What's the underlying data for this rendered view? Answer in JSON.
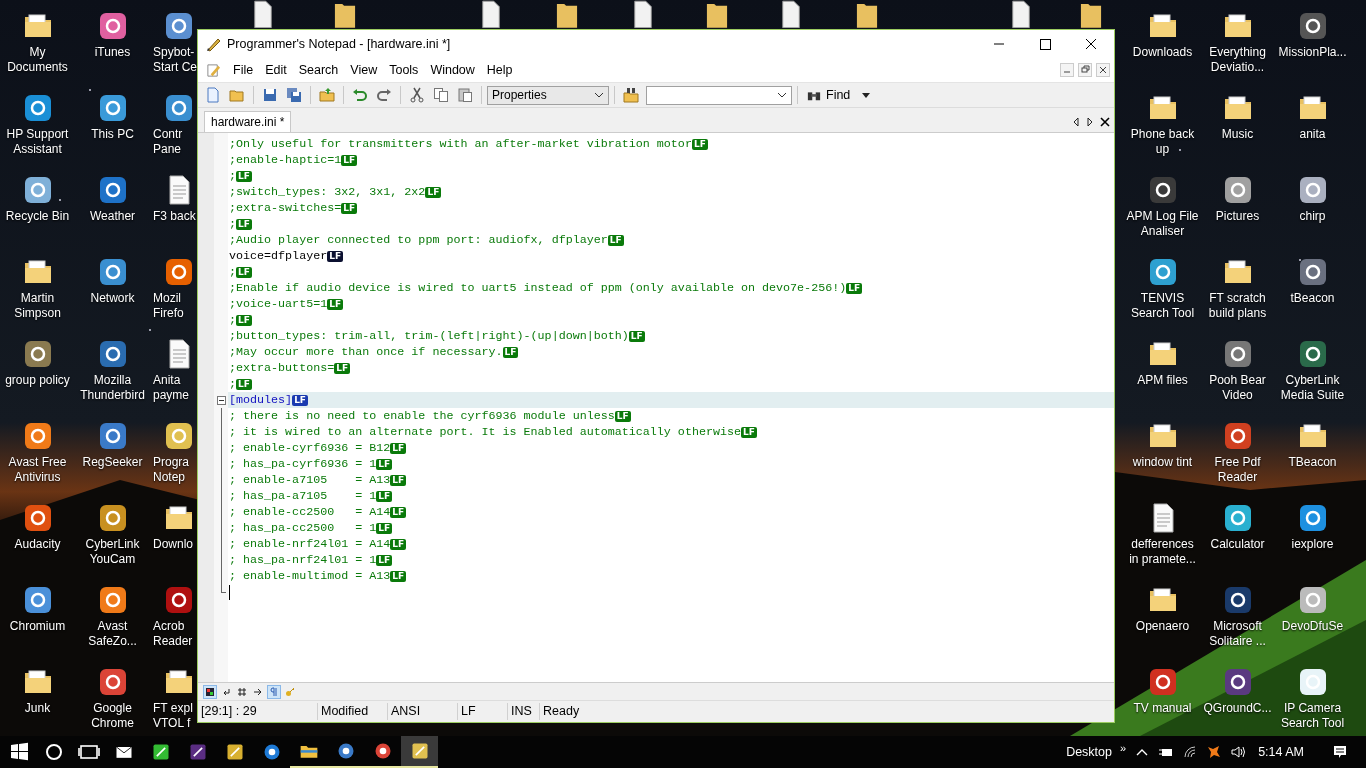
{
  "desktop": {
    "left_icons": [
      {
        "label": "My\nDocuments",
        "kind": "folder"
      },
      {
        "label": "HP Support\nAssistant",
        "kind": "app",
        "color": "#1a8fd6"
      },
      {
        "label": "Recycle Bin",
        "kind": "app",
        "color": "#7fb0d8"
      },
      {
        "label": "Martin\nSimpson",
        "kind": "folder"
      },
      {
        "label": "group policy",
        "kind": "app",
        "color": "#8a7a50"
      },
      {
        "label": "Avast Free\nAntivirus",
        "kind": "app",
        "color": "#f07a18"
      },
      {
        "label": "Audacity",
        "kind": "app",
        "color": "#e05010"
      },
      {
        "label": "Chromium",
        "kind": "app",
        "color": "#4a90d9"
      },
      {
        "label": "Junk",
        "kind": "folder"
      },
      {
        "label": "iTunes",
        "kind": "app",
        "color": "#e060a0"
      },
      {
        "label": "This PC",
        "kind": "app",
        "color": "#3a9ad9"
      },
      {
        "label": "Weather",
        "kind": "app",
        "color": "#1e72c8"
      },
      {
        "label": "Network",
        "kind": "app",
        "color": "#3a8fd0"
      },
      {
        "label": "Mozilla\nThunderbird",
        "kind": "app",
        "color": "#2a6cb0"
      },
      {
        "label": "RegSeeker",
        "kind": "app",
        "color": "#3a7ac8"
      },
      {
        "label": "CyberLink\nYouCam",
        "kind": "app",
        "color": "#c89020"
      },
      {
        "label": "Avast\nSafeZo...",
        "kind": "app",
        "color": "#f07a18"
      },
      {
        "label": "Google\nChrome",
        "kind": "app",
        "color": "#db4437"
      },
      {
        "label": "Spybot-\nStart Ce",
        "kind": "app",
        "color": "#5b8fd0"
      },
      {
        "label": "Contr\nPane",
        "kind": "app",
        "color": "#3a8fd0"
      },
      {
        "label": "F3 back",
        "kind": "document"
      },
      {
        "label": "Mozil\nFirefo",
        "kind": "app",
        "color": "#e66000"
      },
      {
        "label": "Anita\npayme",
        "kind": "document"
      },
      {
        "label": "Progra\nNotep",
        "kind": "app",
        "color": "#e0c050"
      },
      {
        "label": "Downlo",
        "kind": "folder"
      },
      {
        "label": "Acrob\nReader",
        "kind": "app",
        "color": "#b01010"
      },
      {
        "label": "FT expl\nVTOL f",
        "kind": "folder"
      }
    ],
    "right_icons": [
      {
        "label": "Downloads",
        "kind": "folder"
      },
      {
        "label": "Phone back\nup",
        "kind": "folder"
      },
      {
        "label": "APM Log File\nAnaliser",
        "kind": "app",
        "color": "#3a3a3a"
      },
      {
        "label": "TENVIS\nSearch Tool",
        "kind": "app",
        "color": "#2ea0d0"
      },
      {
        "label": "APM files",
        "kind": "folder"
      },
      {
        "label": "window tint",
        "kind": "folder"
      },
      {
        "label": "defferences\nin pramete...",
        "kind": "document"
      },
      {
        "label": "Openaero",
        "kind": "folder"
      },
      {
        "label": "TV manual",
        "kind": "app",
        "color": "#d03020"
      },
      {
        "label": "Everything\nDeviatio...",
        "kind": "folder"
      },
      {
        "label": "Music",
        "kind": "folder"
      },
      {
        "label": "Pictures",
        "kind": "app",
        "color": "#a0a0a0"
      },
      {
        "label": "FT scratch\nbuild plans",
        "kind": "folder"
      },
      {
        "label": "Pooh Bear\nVideo",
        "kind": "app",
        "color": "#777777"
      },
      {
        "label": "Free Pdf\nReader",
        "kind": "app",
        "color": "#d04020"
      },
      {
        "label": "Calculator",
        "kind": "app",
        "color": "#2ab0d0"
      },
      {
        "label": "Microsoft\nSolitaire ...",
        "kind": "app",
        "color": "#1a3a6a"
      },
      {
        "label": "QGroundC...",
        "kind": "app",
        "color": "#5a3a80"
      },
      {
        "label": "MissionPla...",
        "kind": "app",
        "color": "#555555"
      },
      {
        "label": "anita",
        "kind": "folder"
      },
      {
        "label": "chirp",
        "kind": "app",
        "color": "#aab0c0"
      },
      {
        "label": "tBeacon",
        "kind": "app",
        "color": "#6a7080"
      },
      {
        "label": "CyberLink\nMedia Suite",
        "kind": "app",
        "color": "#2a6a4a"
      },
      {
        "label": "TBeacon",
        "kind": "folder"
      },
      {
        "label": "iexplore",
        "kind": "app",
        "color": "#1e90e0"
      },
      {
        "label": "DevoDfuSe",
        "kind": "app",
        "color": "#bbbbbb"
      },
      {
        "label": "IP Camera\nSearch Tool",
        "kind": "app",
        "color": "#e8f4f8"
      }
    ]
  },
  "window": {
    "title": "Programmer's Notepad - [hardware.ini *]",
    "menus": [
      "File",
      "Edit",
      "Search",
      "View",
      "Tools",
      "Window",
      "Help"
    ],
    "toolbar": {
      "scheme_select": "Properties",
      "find_label": "Find"
    },
    "tabs": [
      {
        "label": "hardware.ini *",
        "selected": true
      }
    ],
    "editor": {
      "caret_at_end": true,
      "lines": [
        {
          "text": ";Only useful for transmitters with an after-market vibration motor",
          "kind": "comment",
          "eol": "LF",
          "highlighted": false
        },
        {
          "text": ";enable-haptic=1",
          "kind": "comment",
          "eol": "LF",
          "highlighted": false
        },
        {
          "text": ";",
          "kind": "comment",
          "eol": "LF",
          "highlighted": false
        },
        {
          "text": ";switch_types: 3x2, 3x1, 2x2",
          "kind": "comment",
          "eol": "LF",
          "highlighted": false
        },
        {
          "text": ";extra-switches=",
          "kind": "comment",
          "eol": "LF",
          "highlighted": false
        },
        {
          "text": ";",
          "kind": "comment",
          "eol": "LF",
          "highlighted": false
        },
        {
          "text": ";Audio player connected to ppm port: audiofx, dfplayer",
          "kind": "comment",
          "eol": "LF",
          "highlighted": false
        },
        {
          "text": "voice=dfplayer",
          "kind": "plain",
          "eol": "LF",
          "highlighted": false
        },
        {
          "text": ";",
          "kind": "comment",
          "eol": "LF",
          "highlighted": false
        },
        {
          "text": ";Enable if audio device is wired to uart5 instead of ppm (only available on devo7e-256!)",
          "kind": "comment",
          "eol": "LF",
          "highlighted": false
        },
        {
          "text": ";voice-uart5=1",
          "kind": "comment",
          "eol": "LF",
          "highlighted": false
        },
        {
          "text": ";",
          "kind": "comment",
          "eol": "LF",
          "highlighted": false
        },
        {
          "text": ";button_types: trim-all, trim-(left|right)-(up|down|both)",
          "kind": "comment",
          "eol": "LF",
          "highlighted": false
        },
        {
          "text": ";May occur more than once if necessary.",
          "kind": "comment",
          "eol": "LF",
          "highlighted": false
        },
        {
          "text": ";extra-buttons=",
          "kind": "comment",
          "eol": "LF",
          "highlighted": false
        },
        {
          "text": ";",
          "kind": "comment",
          "eol": "LF",
          "highlighted": false
        },
        {
          "text": "[modules]",
          "kind": "section",
          "eol": "LF",
          "highlighted": true,
          "expanded": true,
          "children": [
            {
              "text": "; there is no need to enable the cyrf6936 module unless",
              "kind": "comment",
              "eol": "LF",
              "highlighted": false
            },
            {
              "text": "; it is wired to an alternate port. It is Enabled automatically otherwise",
              "kind": "comment",
              "eol": "LF",
              "highlighted": false
            },
            {
              "text": "; enable-cyrf6936 = B12",
              "kind": "comment",
              "eol": "LF",
              "highlighted": false
            },
            {
              "text": "; has_pa-cyrf6936 = 1",
              "kind": "comment",
              "eol": "LF",
              "highlighted": false
            },
            {
              "text": "; enable-a7105    = A13",
              "kind": "comment",
              "eol": "LF",
              "highlighted": false
            },
            {
              "text": "; has_pa-a7105    = 1",
              "kind": "comment",
              "eol": "LF",
              "highlighted": false
            },
            {
              "text": "; enable-cc2500   = A14",
              "kind": "comment",
              "eol": "LF",
              "highlighted": false
            },
            {
              "text": "; has_pa-cc2500   = 1",
              "kind": "comment",
              "eol": "LF",
              "highlighted": false
            },
            {
              "text": "; enable-nrf24l01 = A14",
              "kind": "comment",
              "eol": "LF",
              "highlighted": false
            },
            {
              "text": "; has_pa-nrf24l01 = 1",
              "kind": "comment",
              "eol": "LF",
              "highlighted": false
            },
            {
              "text": "; enable-multimod = A13",
              "kind": "comment",
              "eol": "LF",
              "highlighted": false
            }
          ]
        }
      ]
    },
    "view_toggles": [
      {
        "on": true
      },
      {
        "on": false
      },
      {
        "on": false
      },
      {
        "on": false
      },
      {
        "on": true
      },
      {
        "on": false
      }
    ],
    "status_bar": [
      "[29:1] : 29",
      "Modified",
      "ANSI",
      "LF",
      "INS",
      "Ready"
    ]
  },
  "taskbar": {
    "apps": [
      {
        "kind": "mail",
        "color": "#ffffff",
        "running": false,
        "selected": false
      },
      {
        "kind": "app",
        "color": "#33bb33",
        "running": false,
        "selected": false
      },
      {
        "kind": "app",
        "color": "#5a2d82",
        "running": false,
        "selected": false
      },
      {
        "kind": "app",
        "color": "#d8b030",
        "running": false,
        "selected": false
      },
      {
        "kind": "globe",
        "color": "#1e7ad6",
        "running": false,
        "selected": false
      },
      {
        "kind": "folder",
        "color": "#f0c040",
        "running": true,
        "selected": false
      },
      {
        "kind": "globe",
        "color": "#3a7ac8",
        "running": true,
        "selected": false
      },
      {
        "kind": "globe",
        "color": "#db4437",
        "running": true,
        "selected": false
      },
      {
        "kind": "app",
        "color": "#e0c050",
        "running": true,
        "selected": true
      }
    ],
    "tray": {
      "desktop_label": "Desktop",
      "overflow": "»",
      "time": "5:14 AM"
    }
  }
}
